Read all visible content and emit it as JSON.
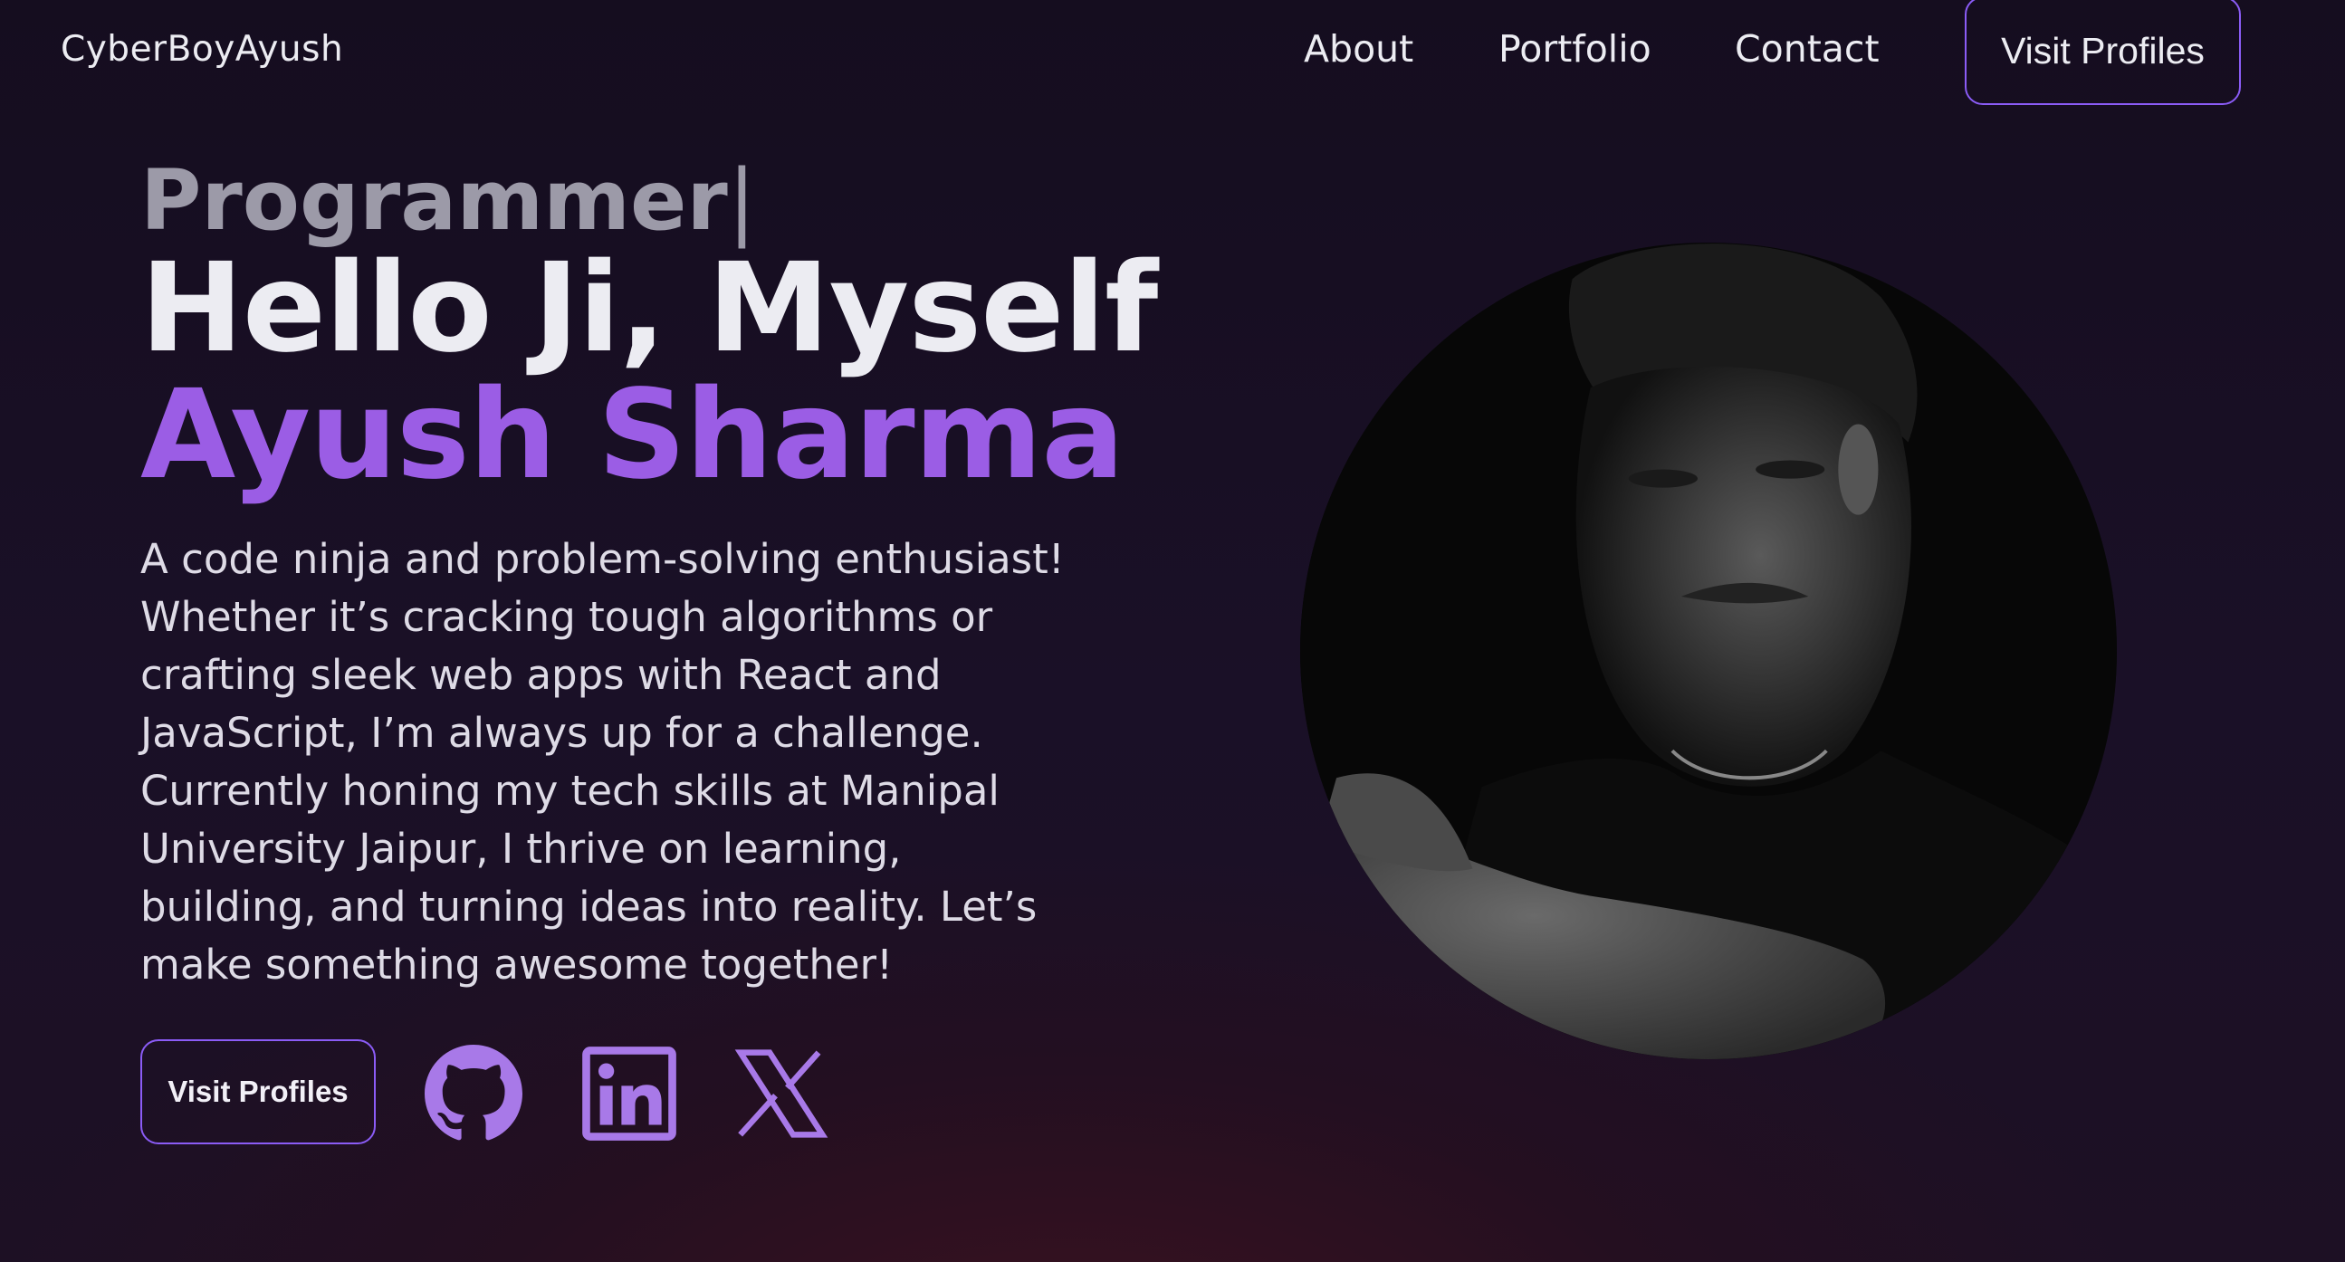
{
  "nav": {
    "brand": "CyberBoyAyush",
    "links": [
      "About",
      "Portfolio",
      "Contact"
    ],
    "cta": "Visit Profiles"
  },
  "hero": {
    "role": "Programmer",
    "caret": "|",
    "greeting": "Hello Ji, Myself",
    "name": "Ayush Sharma",
    "bio": "A code ninja and problem-solving enthusiast! Whether it’s cracking tough algorithms or crafting sleek web apps with React and JavaScript, I’m always up for a challenge. Currently honing my tech skills at Manipal University Jaipur, I thrive on learning, building, and turning ideas into reality. Let’s make something awesome together!",
    "button": "Visit Profiles",
    "social_icons": [
      "github-icon",
      "linkedin-icon",
      "x-icon"
    ]
  },
  "colors": {
    "accent": "#9b5de5",
    "border": "#8b5cf6",
    "background": "#170e22",
    "text": "#ececf2",
    "muted": "#9c9aa8"
  }
}
